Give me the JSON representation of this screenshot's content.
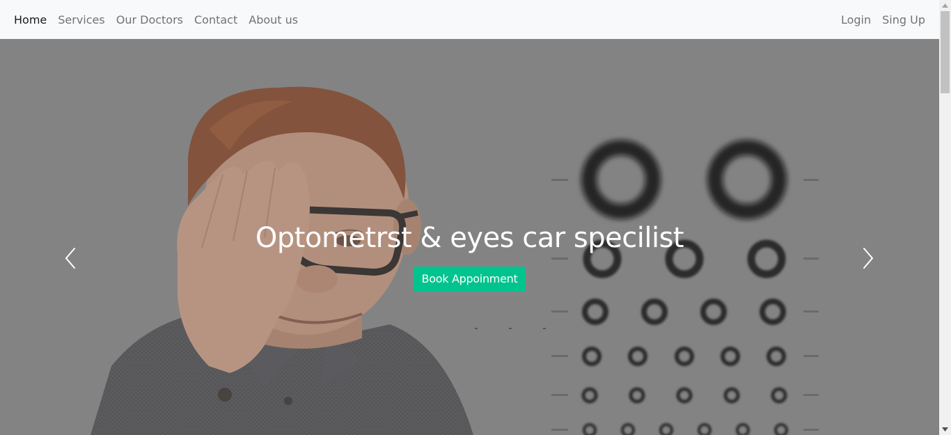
{
  "nav": {
    "left": [
      {
        "label": "Home",
        "active": true
      },
      {
        "label": "Services"
      },
      {
        "label": "Our Doctors"
      },
      {
        "label": "Contact"
      },
      {
        "label": "About us"
      }
    ],
    "right": [
      {
        "label": "Login"
      },
      {
        "label": "Sing Up"
      }
    ]
  },
  "hero": {
    "title": "Optometrst & eyes car specilist",
    "button_label": "Book Appoinment",
    "prev_icon": "chevron-left-icon",
    "next_icon": "chevron-right-icon",
    "image": "boy-covering-eye-with-eye-chart"
  },
  "colors": {
    "navbar_bg": "#f8f9fa",
    "accent": "#00c38d",
    "text_muted": "rgba(0,0,0,0.55)"
  }
}
